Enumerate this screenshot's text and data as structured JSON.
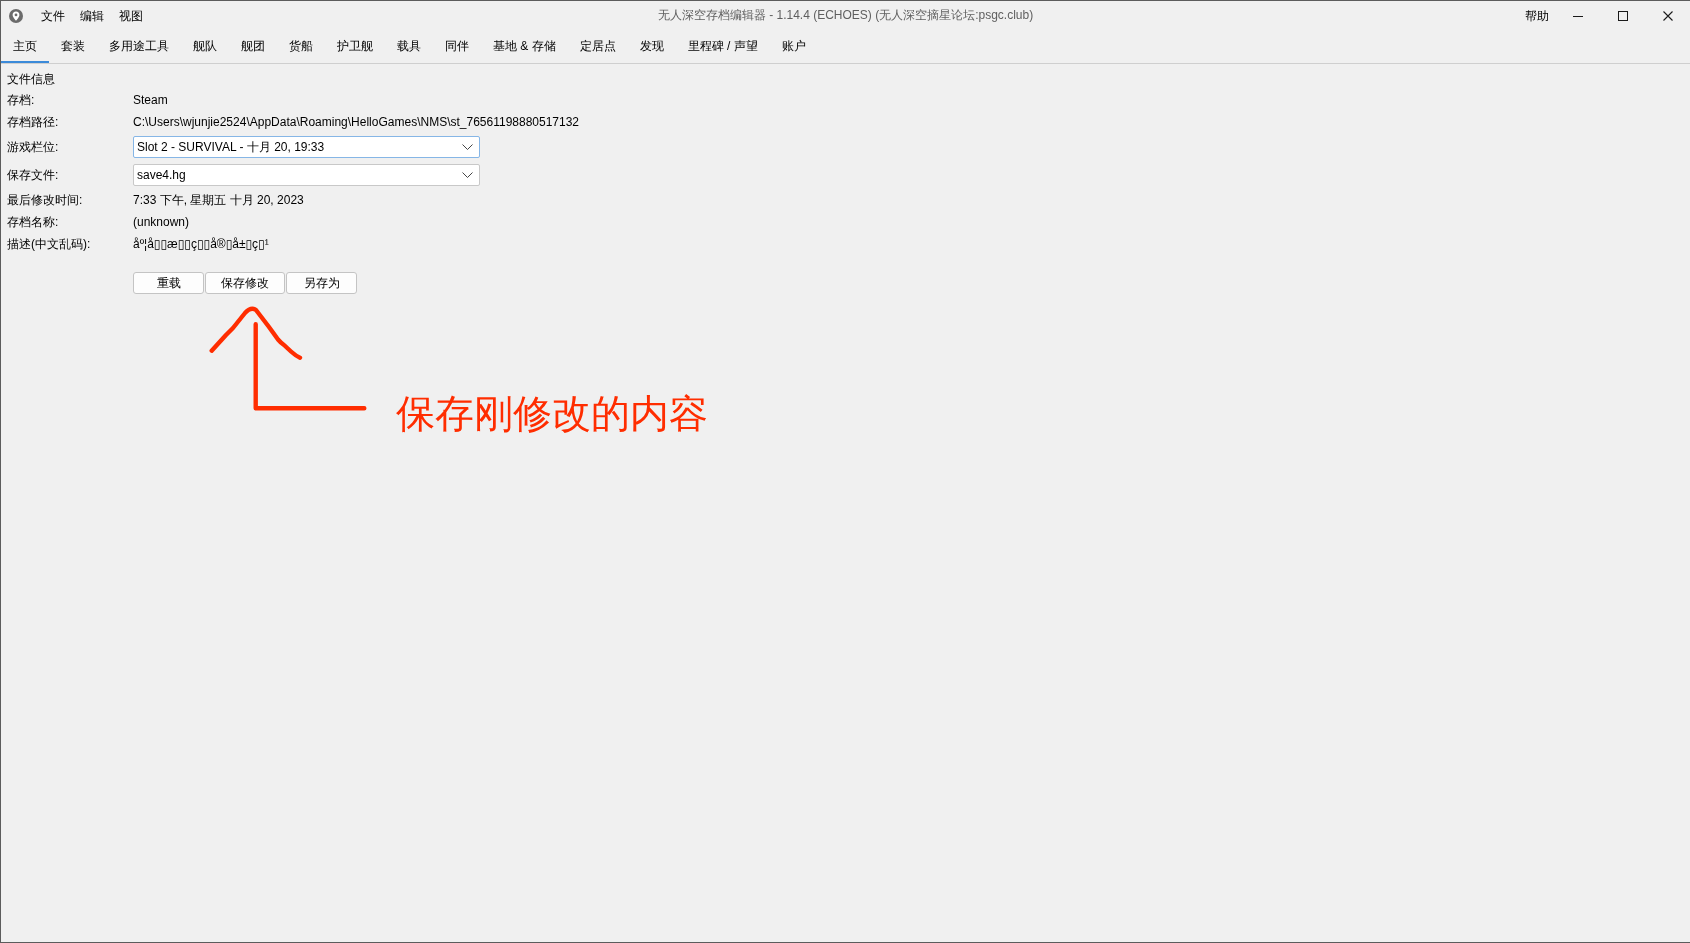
{
  "window": {
    "title": "无人深空存档编辑器 - 1.14.4 (ECHOES) (无人深空摘星论坛:psgc.club)"
  },
  "menu": [
    "文件",
    "编辑",
    "视图"
  ],
  "help_menu": "帮助",
  "tabs": [
    {
      "label": "主页",
      "selected": true
    },
    {
      "label": "套装",
      "selected": false
    },
    {
      "label": "多用途工具",
      "selected": false
    },
    {
      "label": "舰队",
      "selected": false
    },
    {
      "label": "舰团",
      "selected": false
    },
    {
      "label": "货船",
      "selected": false
    },
    {
      "label": "护卫舰",
      "selected": false
    },
    {
      "label": "载具",
      "selected": false
    },
    {
      "label": "同伴",
      "selected": false
    },
    {
      "label": "基地 & 存储",
      "selected": false
    },
    {
      "label": "定居点",
      "selected": false
    },
    {
      "label": "发现",
      "selected": false
    },
    {
      "label": "里程碑 / 声望",
      "selected": false
    },
    {
      "label": "账户",
      "selected": false
    }
  ],
  "file_info": {
    "heading": "文件信息",
    "fields": [
      {
        "kind": "text",
        "label": "存档:",
        "value": "Steam"
      },
      {
        "kind": "text",
        "label": "存档路径:",
        "value": "C:\\Users\\wjunjie2524\\AppData\\Roaming\\HelloGames\\NMS\\st_76561198880517132"
      },
      {
        "kind": "dropdown",
        "label": "游戏栏位:",
        "value": "Slot 2 - SURVIVAL - 十月 20, 19:33",
        "focused": true
      },
      {
        "kind": "dropdown",
        "label": "保存文件:",
        "value": "save4.hg",
        "focused": false
      },
      {
        "kind": "text",
        "label": "最后修改时间:",
        "value": "7:33 下午, 星期五 十月 20, 2023"
      },
      {
        "kind": "text",
        "label": "存档名称:",
        "value": "(unknown)"
      },
      {
        "kind": "text",
        "label": "描述(中文乱码):",
        "value": "åº¦å▯▯æ▯▯ç▯▯å®▯å±▯ç▯¹"
      }
    ],
    "buttons": [
      "重载",
      "保存修改",
      "另存为"
    ]
  },
  "annotation": {
    "text": "保存刚修改的内容"
  }
}
